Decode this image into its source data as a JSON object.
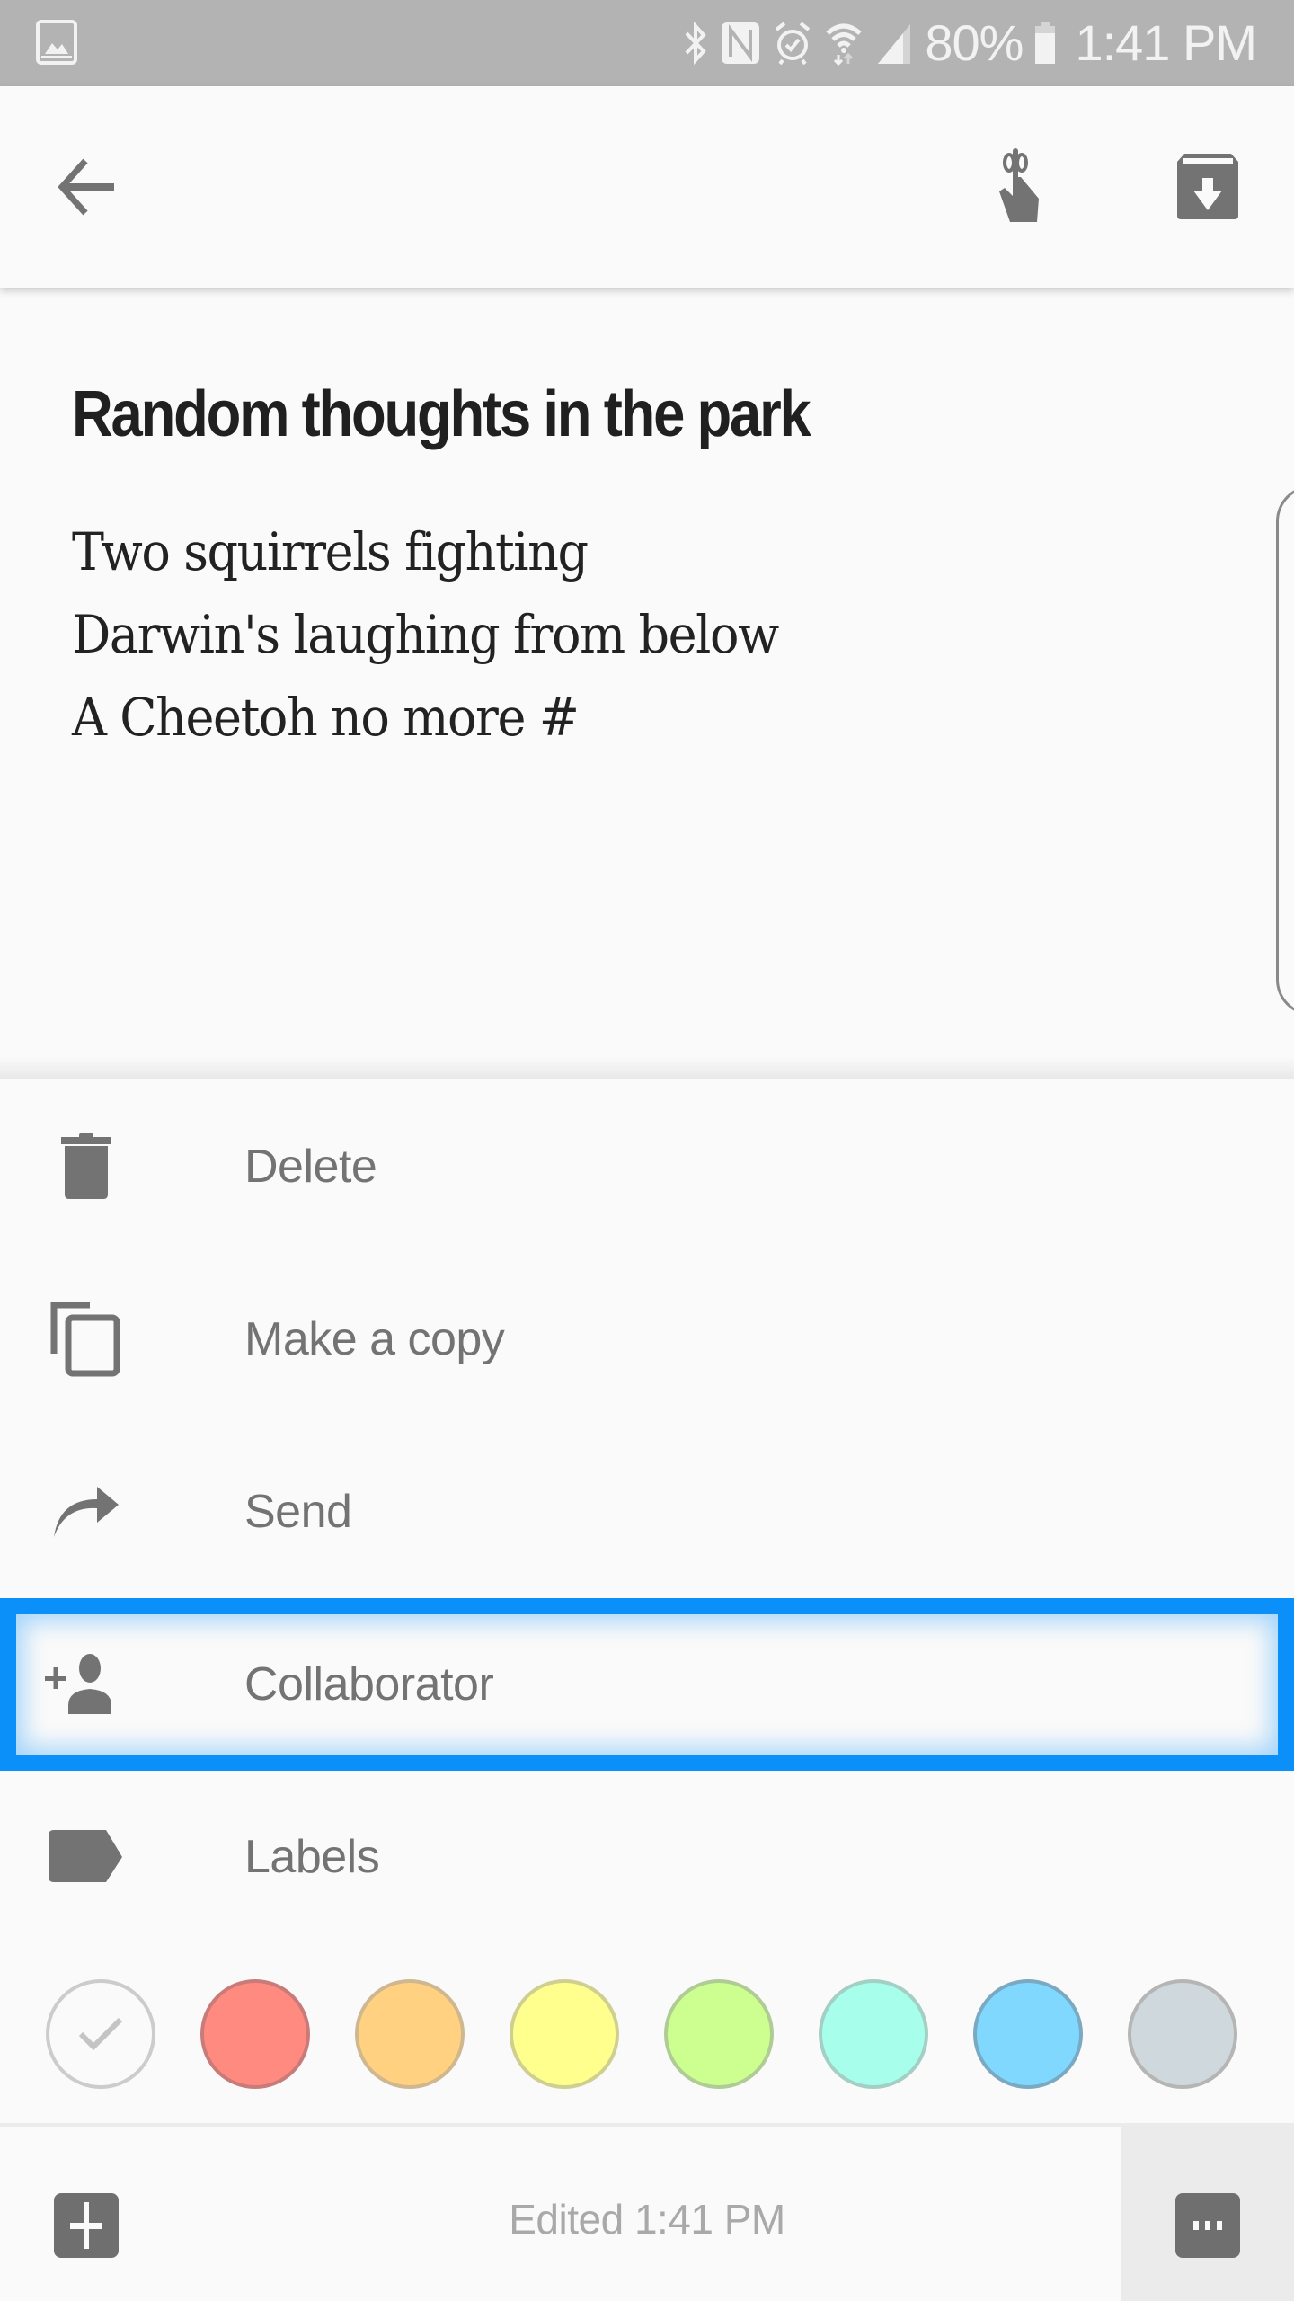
{
  "status_bar": {
    "left_icon": "gallery-notification-icon",
    "icons": [
      "bluetooth-icon",
      "nfc-icon",
      "alarm-icon",
      "wifi-icon",
      "cell-signal-icon"
    ],
    "battery_percent": "80%",
    "battery_level": 0.8,
    "time": "1:41 PM"
  },
  "toolbar": {
    "back_icon": "arrow-back-icon",
    "reminder_icon": "reminder-finger-icon",
    "archive_icon": "archive-icon"
  },
  "note": {
    "title": "Random thoughts in the park",
    "body_lines": [
      "Two squirrels fighting",
      "Darwin's laughing from below",
      "A Cheetoh no more #"
    ]
  },
  "menu": {
    "items": [
      {
        "label": "Delete",
        "icon": "trash-icon"
      },
      {
        "label": "Make a copy",
        "icon": "copy-icon"
      },
      {
        "label": "Send",
        "icon": "share-arrow-icon"
      },
      {
        "label": "Collaborator",
        "icon": "person-add-icon",
        "highlighted": true
      },
      {
        "label": "Labels",
        "icon": "label-icon"
      }
    ],
    "highlight_color": "#0a90f8"
  },
  "colors": {
    "swatches": [
      {
        "name": "default",
        "fill": "#fafafa",
        "border": "#cccccc",
        "selected": true
      },
      {
        "name": "red",
        "fill": "#ff8a80",
        "border": "#c97b79",
        "selected": false
      },
      {
        "name": "orange",
        "fill": "#ffd180",
        "border": "#cfb78f",
        "selected": false
      },
      {
        "name": "yellow",
        "fill": "#ffff8d",
        "border": "#cfcf90",
        "selected": false
      },
      {
        "name": "green",
        "fill": "#ccff90",
        "border": "#b0cc95",
        "selected": false
      },
      {
        "name": "teal",
        "fill": "#a7ffeb",
        "border": "#a3cfc4",
        "selected": false
      },
      {
        "name": "blue",
        "fill": "#80d8ff",
        "border": "#7aa9c2",
        "selected": false
      },
      {
        "name": "gray",
        "fill": "#cfd8dc",
        "border": "#b5b5b5",
        "selected": false
      }
    ]
  },
  "bottom_bar": {
    "add_icon": "add-box-icon",
    "edited_text": "Edited 1:41 PM",
    "more_icon": "more-horiz-icon"
  }
}
